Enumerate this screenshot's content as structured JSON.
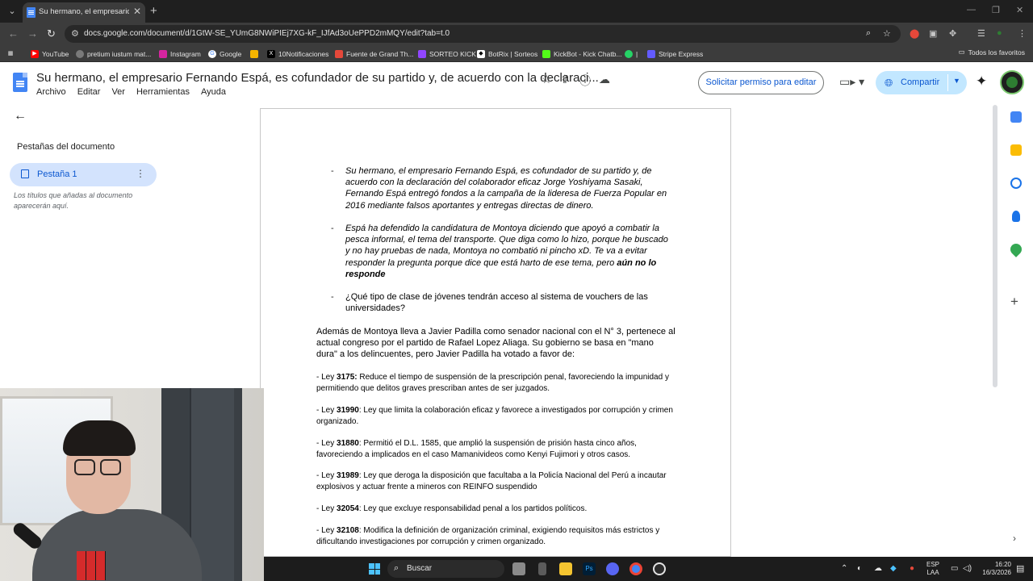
{
  "browser": {
    "tab_title": "Su hermano, el empresario Fern",
    "url": "docs.google.com/document/d/1GtW-SE_YUmG8NWiPIEj7XG-kF_IJfAd3oUePPD2mMQY/edit?tab=t.0",
    "bookmarks": [
      {
        "label": "YouTube",
        "icon": "youtube-icon",
        "color": "#ff0000"
      },
      {
        "label": "pretium iustum mat...",
        "icon": "globe-icon",
        "color": "#7a7a7a"
      },
      {
        "label": "Instagram",
        "icon": "instagram-icon",
        "color": "#d6249f"
      },
      {
        "label": "Google",
        "icon": "google-icon",
        "color": "#4285f4"
      },
      {
        "label": "",
        "icon": "bookmark-icon",
        "color": "#f4b400"
      },
      {
        "label": "10Notificaciones",
        "icon": "x-icon",
        "color": "#000000"
      },
      {
        "label": "Fuente de Grand Th...",
        "icon": "doc-icon",
        "color": "#e5483a"
      },
      {
        "label": "SORTEO KICK",
        "icon": "kick-icon",
        "color": "#9146ff"
      },
      {
        "label": "BotRix | Sorteos",
        "icon": "botrix-icon",
        "color": "#ffffff"
      },
      {
        "label": "KickBot - Kick Chatb...",
        "icon": "kickbot-icon",
        "color": "#53fc18"
      },
      {
        "label": "|",
        "icon": "whatsapp-icon",
        "color": "#25d366"
      },
      {
        "label": "Stripe Express",
        "icon": "stripe-icon",
        "color": "#635bff"
      }
    ],
    "all_bookmarks": "Todos los favoritos"
  },
  "docs": {
    "title": "Su hermano, el empresario Fernando Espá, es cofundador de su partido y, de acuerdo con la declaraci...",
    "menu": [
      "Archivo",
      "Editar",
      "Ver",
      "Herramientas",
      "Ayuda"
    ],
    "request_edit": "Solicitar permiso para editar",
    "share": "Compartir",
    "accent_color": "#0b57d0"
  },
  "outline": {
    "heading": "Pestañas del documento",
    "tab_label": "Pestaña 1",
    "hint": "Los títulos que añadas al documento aparecerán aquí."
  },
  "document": {
    "bullets": [
      {
        "marker": "-",
        "text": "Su hermano, el empresario Fernando Espá, es cofundador de su partido y, de acuerdo con la declaración del colaborador eficaz Jorge Yoshiyama Sasaki, Fernando Espá entregó fondos a la campaña de la lideresa de Fuerza Popular en 2016 mediante falsos aportantes y entregas directas de dinero."
      },
      {
        "marker": "-",
        "text": "Espá ha defendido la candidatura de Montoya diciendo que apoyó a combatir la pesca informal, el tema del transporte. Que diga como lo hizo, porque he buscado y no hay pruebas de nada, Montoya no combatió ni pincho xD. Te va a evitar responder la pregunta porque dice que está harto de ese tema, pero ",
        "bold": "aún no lo responde"
      },
      {
        "marker": "-",
        "text": "¿Qué tipo de clase de jóvenes tendrán acceso al sistema de vouchers de las universidades?"
      }
    ],
    "paragraph": "Además de Montoya lleva a Javier Padilla como senador nacional con el N° 3, pertenece al actual congreso por el partido de Rafael Lopez Aliaga. Su gobierno se basa en \"mano dura\" a los delincuentes, pero Javier Padilla ha votado a favor de:",
    "laws": [
      {
        "prefix": "- Ley ",
        "number": "3175:",
        "text": " Reduce el tiempo de suspensión de la prescripción penal, favoreciendo la impunidad y permitiendo que delitos graves prescriban antes de ser juzgados."
      },
      {
        "prefix": "- Ley ",
        "number": "31990",
        "text": ": Ley que limita la colaboración eficaz y favorece a investigados por corrupción y crimen organizado."
      },
      {
        "prefix": "- Ley ",
        "number": "31880",
        "text": ": Permitió el D.L. 1585, que amplió la suspensión de prisión hasta cinco años, favoreciendo a implicados en el caso Mamanivideos como Kenyi Fujimori y otros casos."
      },
      {
        "prefix": "- Ley ",
        "number": "31989",
        "text": ": Ley que deroga la disposición que facultaba a la Policía Nacional del Perú a incautar explosivos y actuar frente a mineros con REINFO suspendido"
      },
      {
        "prefix": "- Ley ",
        "number": "32054",
        "text": ": Ley que excluye responsabilidad penal a los partidos políticos."
      },
      {
        "prefix": "- Ley ",
        "number": "32108",
        "text": ": Modifica la definición de organización criminal, exigiendo requisitos más estrictos y dificultando investigaciones por corrupción y crimen organizado."
      }
    ]
  },
  "taskbar": {
    "search_label": "Buscar",
    "lang_line1": "ESP",
    "lang_line2": "LAA",
    "time": "16:20",
    "date": "16/3/2026"
  }
}
